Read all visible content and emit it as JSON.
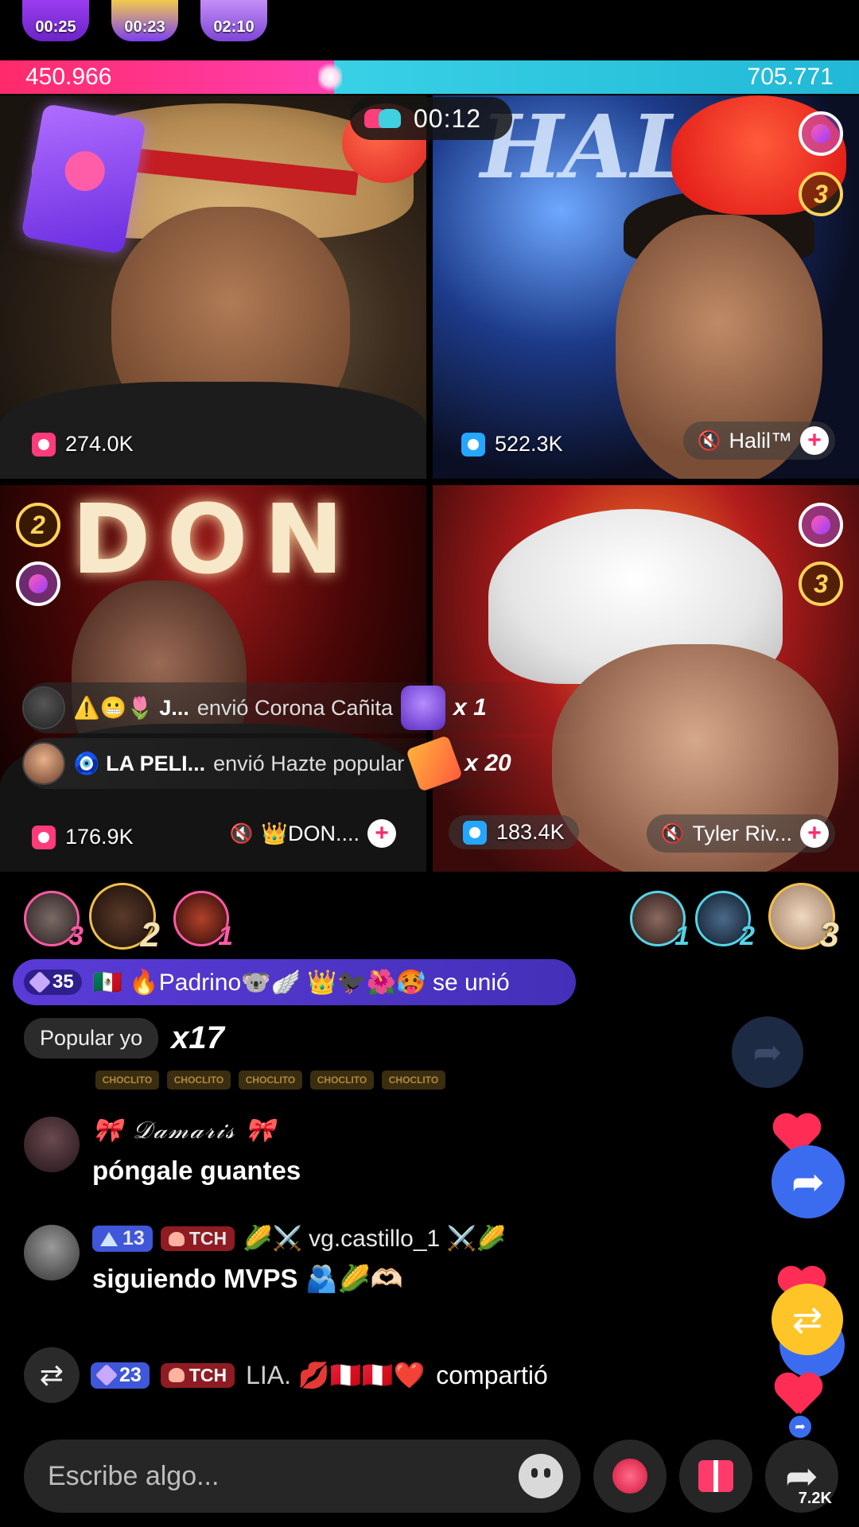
{
  "top_timers": [
    "00:25",
    "00:23",
    "02:10"
  ],
  "score": {
    "left": "450.966",
    "right": "705.771"
  },
  "battle_timer": "00:12",
  "tiles": [
    {
      "gifts": "274.0K",
      "host": ""
    },
    {
      "gifts": "522.3K",
      "host": "Halil™"
    },
    {
      "gifts": "176.9K",
      "host": "👑DON...."
    },
    {
      "gifts": "183.4K",
      "host": "Tyler Riv..."
    }
  ],
  "tile2_logo": "HALI",
  "tile3_sign": "DON",
  "rank_badges": {
    "t2": "3",
    "t3": "2",
    "t4": "3"
  },
  "gift_notices": [
    {
      "name": "⚠️😬🌷 J...",
      "action": "envió Corona Cañita",
      "mult": "x 1"
    },
    {
      "name": "🧿 LA PELI...",
      "action": "envió Hazte popular",
      "mult": "x 20"
    }
  ],
  "ranked_left": [
    "3",
    "2",
    "1"
  ],
  "ranked_right": [
    "1",
    "2",
    "3"
  ],
  "joined": {
    "level": "35",
    "text": "🇲🇽 🔥Padrino🐨🪽 👑🐦‍⬛🌺🥵 se unió"
  },
  "popular": {
    "label": "Popular yo",
    "mult": "x17"
  },
  "team_stickers": [
    "CHOCLITO",
    "CHOCLITO",
    "CHOCLITO",
    "CHOCLITO",
    "CHOCLITO"
  ],
  "chat": [
    {
      "user": "🎀 𝒟𝒶𝓂𝒶𝓇𝒾𝓈 🎀",
      "text": "póngale guantes"
    },
    {
      "level": "13",
      "team": "TCH",
      "user": "🌽⚔️ vg.castillo_1 ⚔️🌽",
      "text": "siguiendo MVPS 🫂🌽🫶🏻"
    }
  ],
  "share_event": {
    "level": "23",
    "team": "TCH",
    "user": "LIA.  💋🇵🇪🇵🇪❤️",
    "action": "compartió"
  },
  "input_placeholder": "Escribe algo...",
  "share_count": "7.2K"
}
